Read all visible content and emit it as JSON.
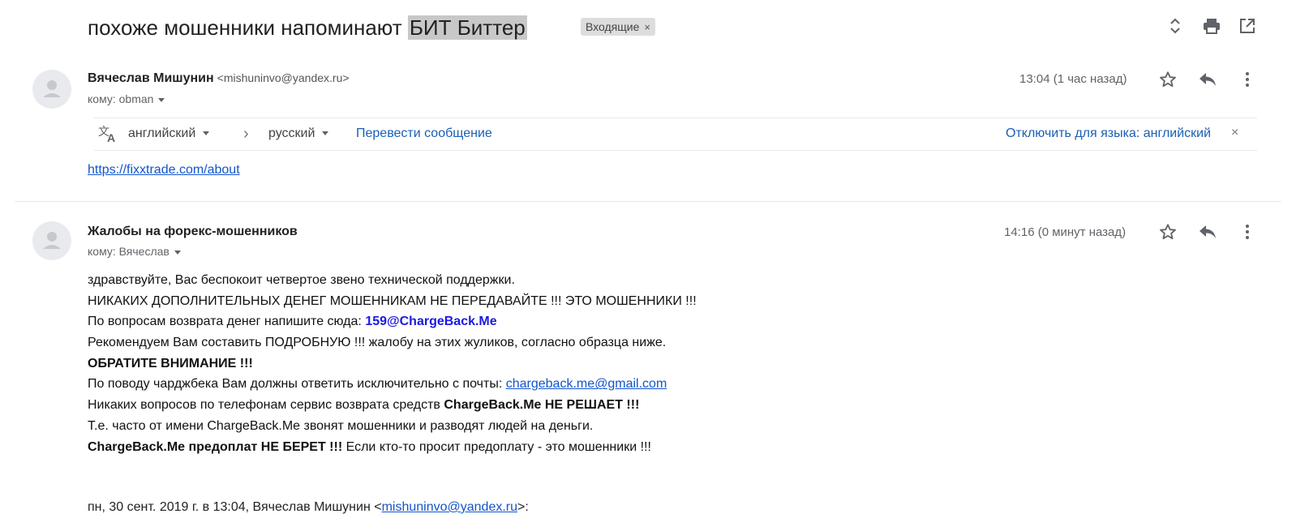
{
  "subject": {
    "prefix": "похоже мошенники напоминают ",
    "highlight": "БИТ Биттер",
    "label": "Входящие",
    "label_close": "×"
  },
  "top_icons": [
    "expand-collapse-icon",
    "print-icon",
    "open-new-window-icon"
  ],
  "message1": {
    "sender_name": "Вячеслав Мишунин",
    "sender_email": "<mishuninvo@yandex.ru>",
    "to": "кому: obman",
    "time": "13:04 (1 час назад)",
    "translate_bar": {
      "from_lang": "английский",
      "arrow": "›",
      "to_lang": "русский",
      "translate_link": "Перевести сообщение",
      "disable_link": "Отключить для языка: английский",
      "close": "×"
    },
    "body_link": "https://fixxtrade.com/about"
  },
  "message2": {
    "sender_name": "Жалобы на форекс-мошенников",
    "to": "кому: Вячеслав",
    "time": "14:16 (0 минут назад)",
    "lines": {
      "l1": "здравствуйте, Вас беспокоит четвертое звено технической поддержки.",
      "l2": "НИКАКИХ ДОПОЛНИТЕЛЬНЫХ ДЕНЕГ МОШЕННИКАМ НЕ ПЕРЕДАВАЙТЕ !!! ЭТО МОШЕННИКИ !!!",
      "l3_prefix": "По вопросам возврата денег напишите сюда: ",
      "l3_email": "159@ChargeBack.Me",
      "l4": "Рекомендуем Вам составить ПОДРОБНУЮ !!! жалобу на этих жуликов, согласно образца ниже.",
      "l5": "ОБРАТИТЕ ВНИМАНИЕ !!!",
      "l6_prefix": "По поводу чарджбека Вам должны ответить исключительно с почты: ",
      "l6_email": "chargeback.me@gmail.com",
      "l7_prefix": "Никаких вопросов по телефонам сервис возврата средств ",
      "l7_bold": "ChargeBack.Me НЕ РЕШАЕТ !!!",
      "l8": "Т.е. часто от имени ChargeBack.Me звонят мошенники и разводят людей на деньги.",
      "l9_bold": "ChargeBack.Me предоплат НЕ БЕРЕТ !!!",
      "l9_rest": " Если кто-то просит предоплату - это мошенники !!!"
    },
    "quote_prefix": "пн, 30 сент. 2019 г. в 13:04, Вячеслав Мишунин <",
    "quote_email": "mishuninvo@yandex.ru",
    "quote_suffix": ">:"
  }
}
